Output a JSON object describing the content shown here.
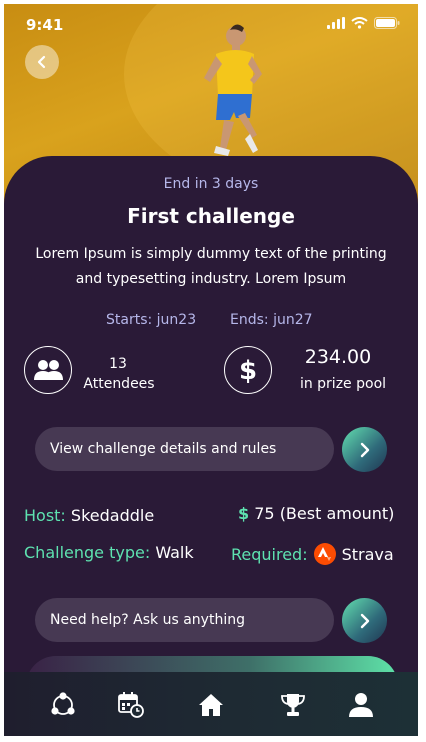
{
  "status_bar": {
    "time": "9:41"
  },
  "challenge": {
    "ends_in": "End in 3 days",
    "title": "First challenge",
    "description": "Lorem Ipsum is simply dummy text of the printing and typesetting industry. Lorem Ipsum",
    "starts": "Starts: jun23",
    "ends": "Ends: jun27"
  },
  "stats": {
    "attendees_count": "13",
    "attendees_label": "Attendees",
    "prize_amount": "234.00",
    "prize_label": "in prize pool",
    "attendees_icon": "people-icon",
    "prize_icon": "dollar-icon"
  },
  "details_button": {
    "label": "View challenge details and rules"
  },
  "info": {
    "host_label": "Host:",
    "host_value": "Skedaddle",
    "amount_value": "75",
    "amount_note": "(Best amount)",
    "type_label": "Challenge type:",
    "type_value": "Walk",
    "required_label": "Required:",
    "required_value": "Strava"
  },
  "help_button": {
    "label": "Need help? Ask us anything"
  },
  "tabbar": {
    "items": [
      "community-icon",
      "calendar-icon",
      "home-icon",
      "trophy-icon",
      "profile-icon"
    ]
  },
  "colors": {
    "background": "#2a1a37",
    "accent_green": "#5ee2b0",
    "muted_lavender": "#b6b7ea",
    "pill": "#473953",
    "hero": "#d9a21d",
    "strava": "#fc4c02"
  }
}
